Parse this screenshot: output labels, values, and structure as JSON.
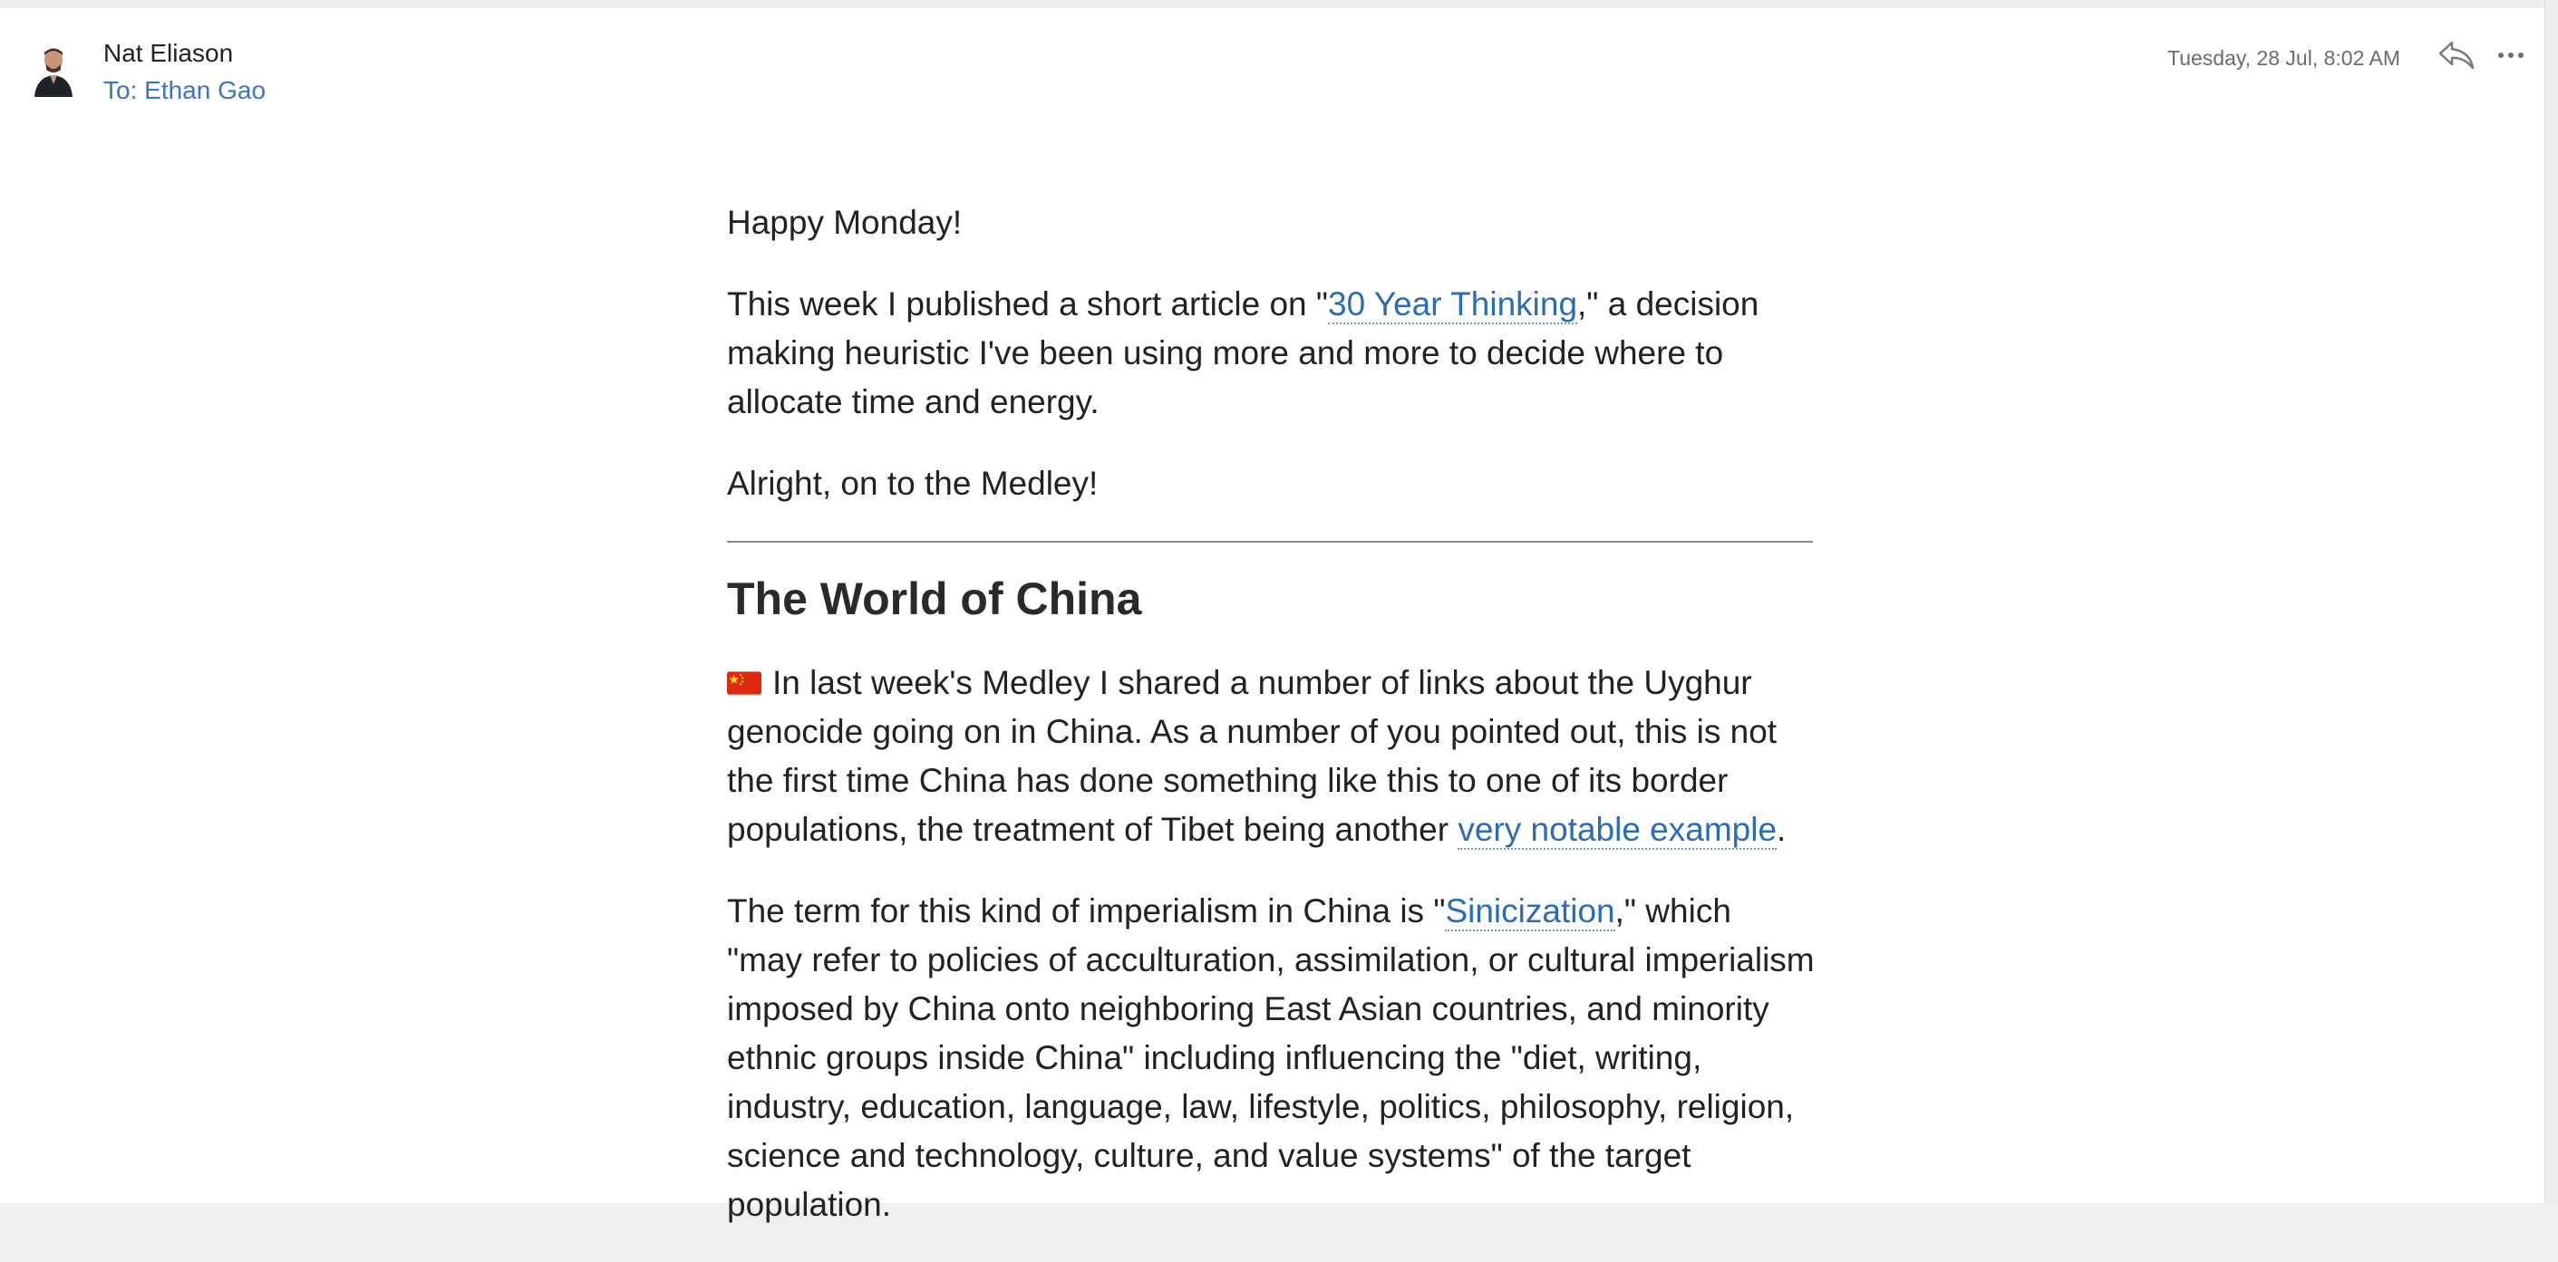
{
  "header": {
    "sender_name": "Nat Eliason",
    "recipient_prefix": "To:",
    "recipient_name": "Ethan Gao",
    "timestamp": "Tuesday, 28 Jul, 8:02 AM",
    "reply_icon": "reply-icon",
    "more_icon": "more-icon"
  },
  "body": {
    "greeting": "Happy Monday!",
    "intro_before": "This week I published a short article on \"",
    "intro_link": "30 Year Thinking",
    "intro_after": ",\" a decision making heuristic I've been using more and more to decide where to allocate time and energy.",
    "transition": "Alright, on to the Medley!",
    "section_title": "The World of China",
    "flag_icon": "china-flag-icon",
    "para1_before": "In last week's Medley I shared a number of links about the Uyghur genocide going on in China. As a number of you pointed out, this is not the first time China has done something like this to one of its border populations, the treatment of Tibet being another ",
    "para1_link": "very notable example",
    "para1_after": ".",
    "para2_before": "The term for this kind of imperialism in China is \"",
    "para2_link": "Sinicization",
    "para2_after": ",\" which \"may refer to policies of acculturation, assimilation, or cultural imperialism imposed by China onto neighboring East Asian countries, and minority ethnic groups inside China\" including influencing the \"diet, writing, industry, education, language, law, lifestyle, politics, philosophy, religion, science and technology, culture, and value systems\" of the target population."
  },
  "colors": {
    "link": "#2b6cb5",
    "recipient": "#3a76c4",
    "text": "#222222",
    "flag_red": "#de2910",
    "flag_star": "#ffde00"
  }
}
